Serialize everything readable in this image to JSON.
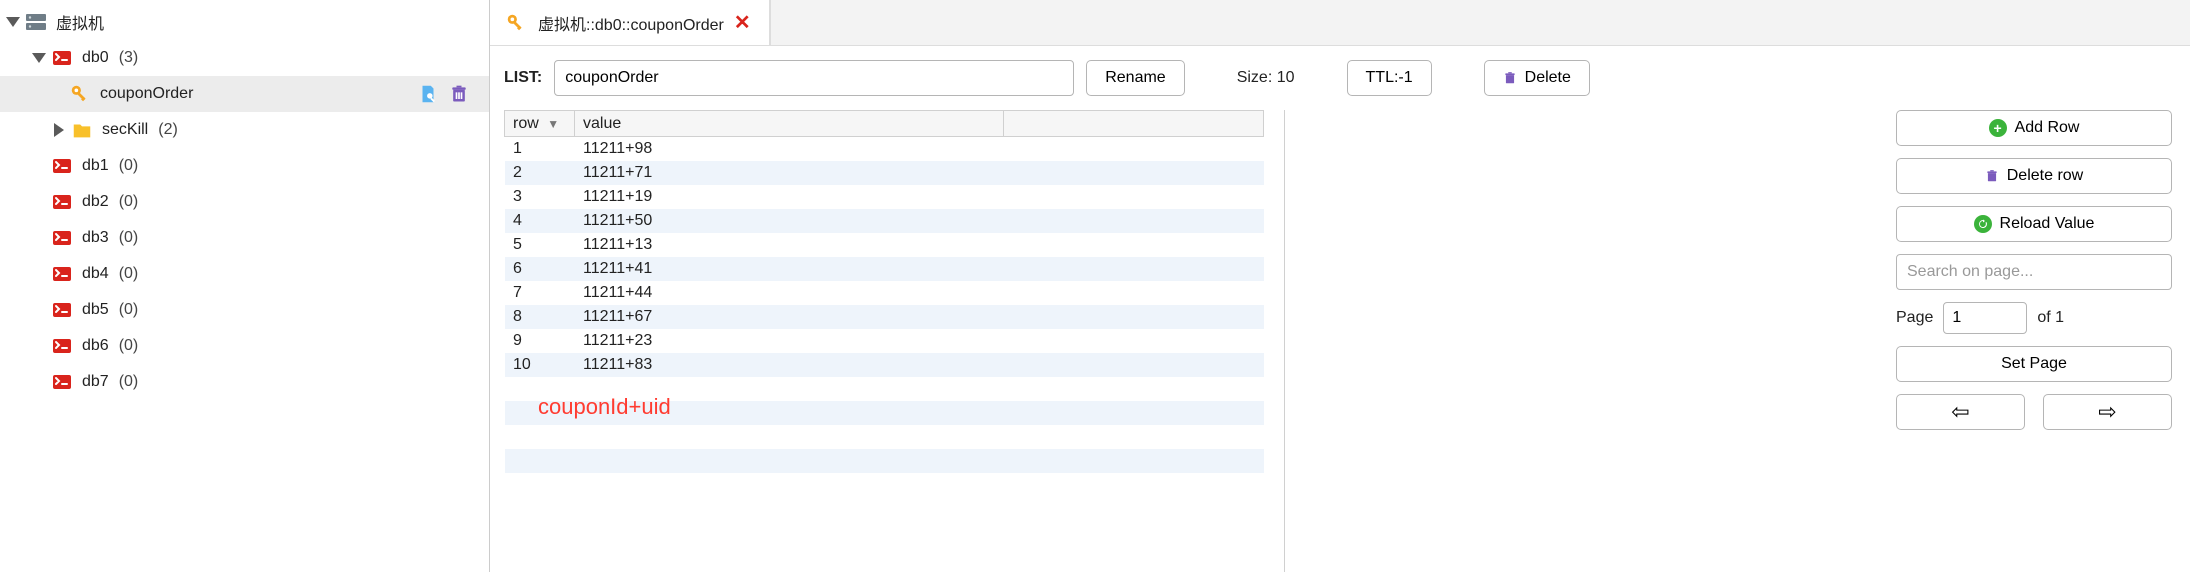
{
  "sidebar": {
    "root": {
      "label": "虚拟机"
    },
    "db0": {
      "label": "db0",
      "count": "(3)"
    },
    "couponOrder": {
      "label": "couponOrder"
    },
    "secKill": {
      "label": "secKill",
      "count": "(2)"
    },
    "dbs": [
      {
        "label": "db1",
        "count": "(0)"
      },
      {
        "label": "db2",
        "count": "(0)"
      },
      {
        "label": "db3",
        "count": "(0)"
      },
      {
        "label": "db4",
        "count": "(0)"
      },
      {
        "label": "db5",
        "count": "(0)"
      },
      {
        "label": "db6",
        "count": "(0)"
      },
      {
        "label": "db7",
        "count": "(0)"
      }
    ]
  },
  "tab": {
    "title": "虚拟机::db0::couponOrder"
  },
  "key": {
    "type_label": "LIST:",
    "name": "couponOrder",
    "rename_btn": "Rename",
    "size_label": "Size: 10",
    "ttl_btn": "TTL:-1",
    "delete_btn": "Delete"
  },
  "table": {
    "col_row": "row",
    "col_value": "value",
    "rows": [
      {
        "row": "1",
        "value": "11211+98"
      },
      {
        "row": "2",
        "value": "11211+71"
      },
      {
        "row": "3",
        "value": "11211+19"
      },
      {
        "row": "4",
        "value": "11211+50"
      },
      {
        "row": "5",
        "value": "11211+13"
      },
      {
        "row": "6",
        "value": "11211+41"
      },
      {
        "row": "7",
        "value": "11211+44"
      },
      {
        "row": "8",
        "value": "11211+67"
      },
      {
        "row": "9",
        "value": "11211+23"
      },
      {
        "row": "10",
        "value": "11211+83"
      }
    ],
    "annotation": "couponId+uid"
  },
  "actions": {
    "add_row": "Add Row",
    "delete_row": "Delete row",
    "reload": "Reload Value",
    "search_placeholder": "Search on page...",
    "page_label": "Page",
    "page_value": "1",
    "page_of": "of 1",
    "set_page": "Set Page"
  },
  "glyphs": {
    "arrow_left": "⇦",
    "arrow_right": "⇨",
    "close_x": "✕",
    "sort_desc": "▼"
  }
}
